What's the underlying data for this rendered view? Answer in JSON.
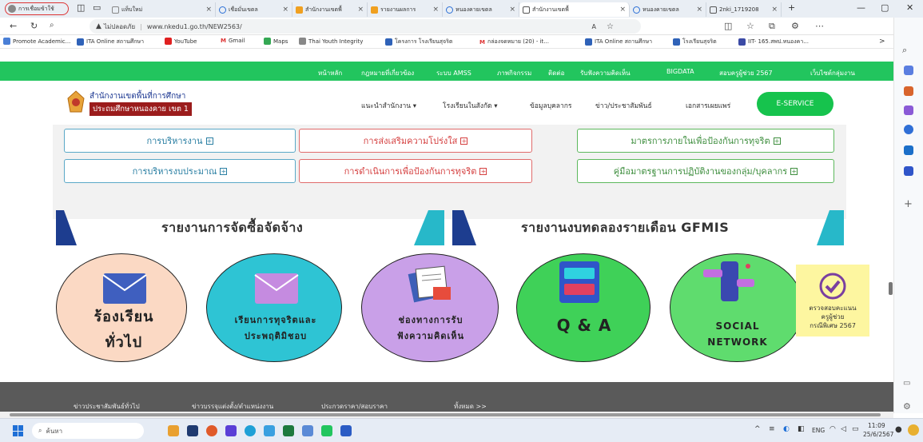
{
  "browser": {
    "profile_label": "การเชื่อมข้าใช้",
    "tabs": [
      {
        "title": "แท็บใหม่"
      },
      {
        "title": "เชื่อมั่นเขตล"
      },
      {
        "title": "สำนักงานเขตพื้"
      },
      {
        "title": "รายงานผลการ"
      },
      {
        "title": "หนองคายเขตล"
      },
      {
        "title": "สำนักงานเขตพื้"
      },
      {
        "title": "หนองคายเขตล"
      },
      {
        "title": "2nki_1719208"
      }
    ],
    "new_tab": "+",
    "security_label": "ไม่ปลอดภัย",
    "url": "www.nkedu1.go.th/NEW2563/",
    "bookmarks": [
      "Promote Academic...",
      "ITA Online สถานศึกษา",
      "YouTube",
      "Gmail",
      "Maps",
      "Thai Youth Integrity",
      "โครงการ โรงเรียนสุจริต",
      "กล่องจดหมาย (20) - it...",
      "ITA Online สถานศึกษา",
      "โรงเรียนสุจริต",
      "IIT- 165.สพป.หนองคา..."
    ],
    "bookmarks_more": ">"
  },
  "site": {
    "top_nav": [
      "หน้าหลัก",
      "กฎหมายที่เกี่ยวข้อง",
      "ระบบ AMSS",
      "ภาพกิจกรรม",
      "ติดต่อ",
      "รับฟังความคิดเห็น",
      "BIGDATA",
      "สอบครูผู้ช่วย 2567",
      "เว็บไซต์กลุ่มงาน"
    ],
    "logo_line1": "สำนักงานเขตพื้นที่การศึกษา",
    "logo_line2": "ประถมศึกษาหนองคาย เขต 1",
    "main_nav": [
      "แนะนำสำนักงาน ▾",
      "โรงเรียนในสังกัด ▾",
      "ข้อมูลบุคลากร",
      "ข่าว/ประชาสัมพันธ์",
      "เอกสารเผยแพร่"
    ],
    "eservice_label": "E-SERVICE",
    "grid_buttons": [
      "การบริหารงาน",
      "การส่งเสริมความโปร่งใส",
      "มาตรการภายในเพื่อป้องกันการทุจริต",
      "การบริหารงบประมาณ",
      "การดำเนินการเพื่อป้องกันการทุจริต",
      "คู่มือมาตรฐานการปฏิบัติงานของกลุ่ม/บุคลากร"
    ],
    "plus_sign": "+",
    "banner_left": "รายงานการจัดซื้อจัดจ้าง",
    "banner_right": "รายงานงบทดลองรายเดือน GFMIS",
    "circles": [
      {
        "line1": "ร้องเรียน",
        "line2": "ทั่วไป"
      },
      {
        "line1": "เรียนการทุจริตและ",
        "line2": "ประพฤติมิชอบ"
      },
      {
        "line1": "ช่องทางการรับ",
        "line2": "ฟังความคิดเห็น"
      },
      {
        "line1": "Q & A"
      },
      {
        "line1": "SOCIAL",
        "line2": "NETWORK"
      }
    ],
    "check_card": {
      "line1": "ตรวจสอบคะแนน",
      "line2": "ครูผู้ช่วย",
      "line3": "กรณีพิเศษ 2567"
    },
    "bottom_nav": [
      "ข่าวประชาสัมพันธ์ทั่วไป",
      "ข่าวบรรจุแต่งตั้ง/ตำแหน่งงาน",
      "ประกวดราคา/สอบราคา",
      "ทั้งหมด >>"
    ]
  },
  "taskbar": {
    "search_placeholder": "ค้นหา",
    "lang": "ENG",
    "time": "11:09",
    "date": "25/6/2567"
  },
  "colors": {
    "accent_green": "#22c55e",
    "eservice": "#16c34d"
  }
}
